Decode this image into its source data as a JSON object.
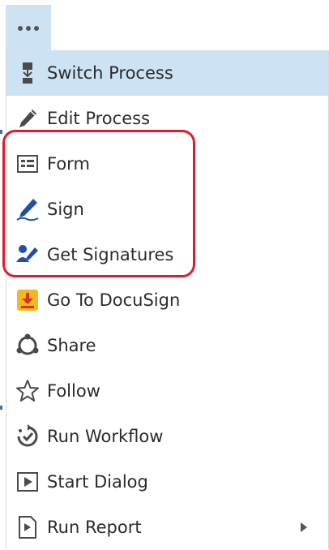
{
  "menu": {
    "items": [
      {
        "label": "Switch Process",
        "icon": "switch-process-icon",
        "active": true
      },
      {
        "label": "Edit Process",
        "icon": "pencil-icon"
      },
      {
        "label": "Form",
        "icon": "form-icon"
      },
      {
        "label": "Sign",
        "icon": "sign-pen-icon"
      },
      {
        "label": "Get Signatures",
        "icon": "get-signatures-icon"
      },
      {
        "label": "Go To DocuSign",
        "icon": "docusign-icon"
      },
      {
        "label": "Share",
        "icon": "share-icon"
      },
      {
        "label": "Follow",
        "icon": "star-icon"
      },
      {
        "label": "Run Workflow",
        "icon": "workflow-icon"
      },
      {
        "label": "Start Dialog",
        "icon": "play-dialog-icon"
      },
      {
        "label": "Run Report",
        "icon": "report-icon",
        "has_submenu": true
      }
    ]
  },
  "colors": {
    "hover_bg": "#cde3f3",
    "highlight_border": "#e21b2c",
    "sign_blue": "#1f4fa8",
    "docusign_yellow": "#f3b81e",
    "docusign_red": "#d9331f"
  }
}
